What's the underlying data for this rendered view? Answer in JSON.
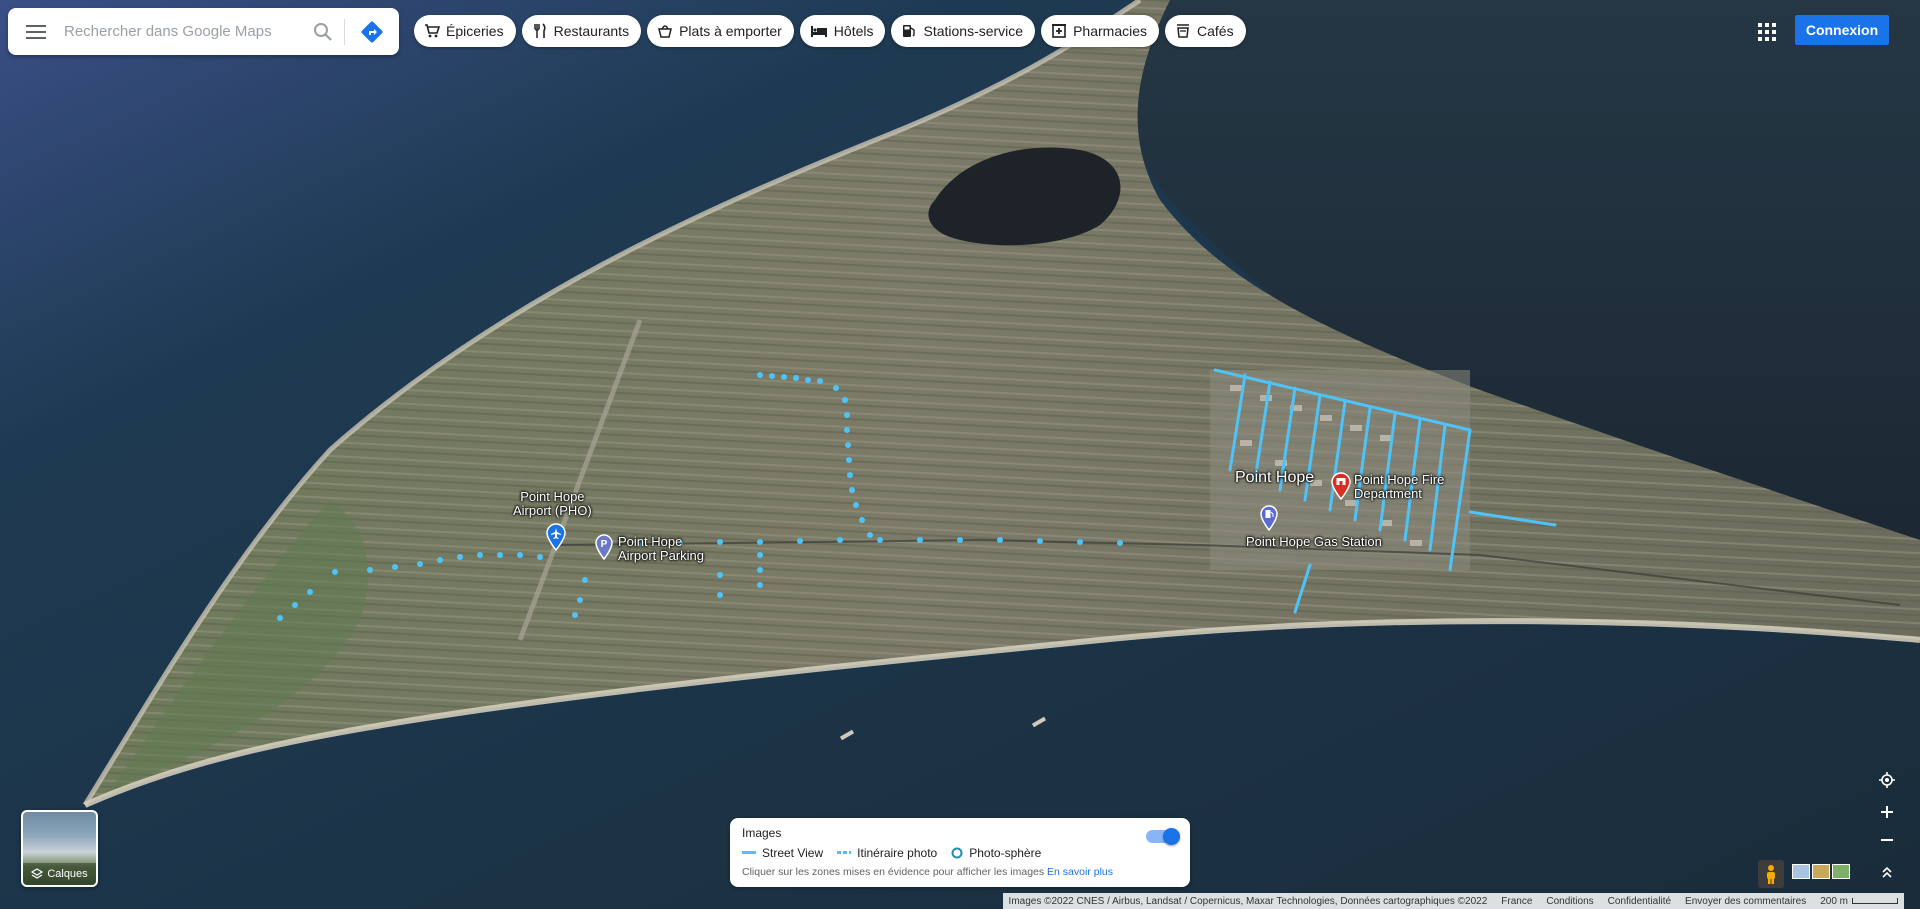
{
  "search": {
    "placeholder": "Rechercher dans Google Maps"
  },
  "categories": [
    {
      "label": "Épiceries",
      "icon": "cart-icon"
    },
    {
      "label": "Restaurants",
      "icon": "cutlery-icon"
    },
    {
      "label": "Plats à emporter",
      "icon": "takeout-icon"
    },
    {
      "label": "Hôtels",
      "icon": "bed-icon"
    },
    {
      "label": "Stations-service",
      "icon": "fuel-icon"
    },
    {
      "label": "Pharmacies",
      "icon": "pharmacy-icon"
    },
    {
      "label": "Cafés",
      "icon": "coffee-icon"
    }
  ],
  "header": {
    "signin_label": "Connexion"
  },
  "map": {
    "labels": {
      "airport": [
        "Point Hope",
        "Airport (PHO)"
      ],
      "parking": [
        "Point Hope",
        "Airport Parking"
      ],
      "town": "Point Hope",
      "fire": [
        "Point Hope Fire",
        "Department"
      ],
      "gas": "Point Hope Gas Station"
    }
  },
  "layers": {
    "label": "Calques"
  },
  "imagery_panel": {
    "title": "Images",
    "legend": [
      "Street View",
      "Itinéraire photo",
      "Photo-sphère"
    ],
    "hint": "Cliquer sur les zones mises en évidence pour afficher les images",
    "learn_more": "En savoir plus",
    "toggle_on": true
  },
  "attribution": {
    "imagery": "Images ©2022 CNES / Airbus, Landsat / Copernicus, Maxar Technologies, Données cartographiques ©2022",
    "country": "France",
    "terms": "Conditions",
    "privacy": "Confidentialité",
    "feedback": "Envoyer des commentaires",
    "scale": "200 m"
  },
  "colors": {
    "accent": "#1a73e8",
    "street_view": "#4fc3f7",
    "fire_pin": "#d93025",
    "gas_pin": "#5b6bd1",
    "airport_pin": "#1a73e8"
  }
}
